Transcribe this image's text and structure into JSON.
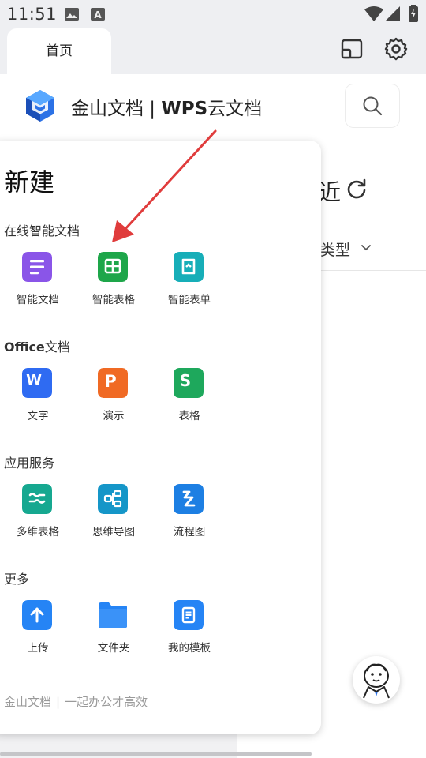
{
  "status": {
    "time": "11:51"
  },
  "tab": {
    "label": "首页"
  },
  "header": {
    "title_prefix": "金山文档 | ",
    "title_bold": "WPS",
    "title_suffix": "云文档"
  },
  "background": {
    "recent_fragment": "近",
    "type_filter": "类型"
  },
  "panel": {
    "title": "新建",
    "sections": [
      {
        "title": "在线智能文档",
        "items": [
          {
            "label": "智能文档",
            "color": "#8a55e8"
          },
          {
            "label": "智能表格",
            "color": "#1ea64a"
          },
          {
            "label": "智能表单",
            "color": "#17aeb8"
          }
        ]
      },
      {
        "title_bold": "Office",
        "title": "文档",
        "items": [
          {
            "label": "文字",
            "color": "#2f6bf2",
            "glyph": "W"
          },
          {
            "label": "演示",
            "color": "#f06a24",
            "glyph": "P"
          },
          {
            "label": "表格",
            "color": "#1ea85c",
            "glyph": "S"
          }
        ]
      },
      {
        "title": "应用服务",
        "items": [
          {
            "label": "多维表格",
            "color": "#16a890"
          },
          {
            "label": "思维导图",
            "color": "#1596c8"
          },
          {
            "label": "流程图",
            "color": "#1d7fe3"
          }
        ]
      },
      {
        "title": "更多",
        "items": [
          {
            "label": "上传",
            "color": "#2584f5"
          },
          {
            "label": "文件夹",
            "color": "#2584f5"
          },
          {
            "label": "我的模板",
            "color": "#2584f5"
          }
        ]
      }
    ],
    "footer": {
      "left": "金山文档",
      "right": "一起办公才高效"
    }
  },
  "annotation": {
    "arrow_color": "#e03c3c"
  }
}
